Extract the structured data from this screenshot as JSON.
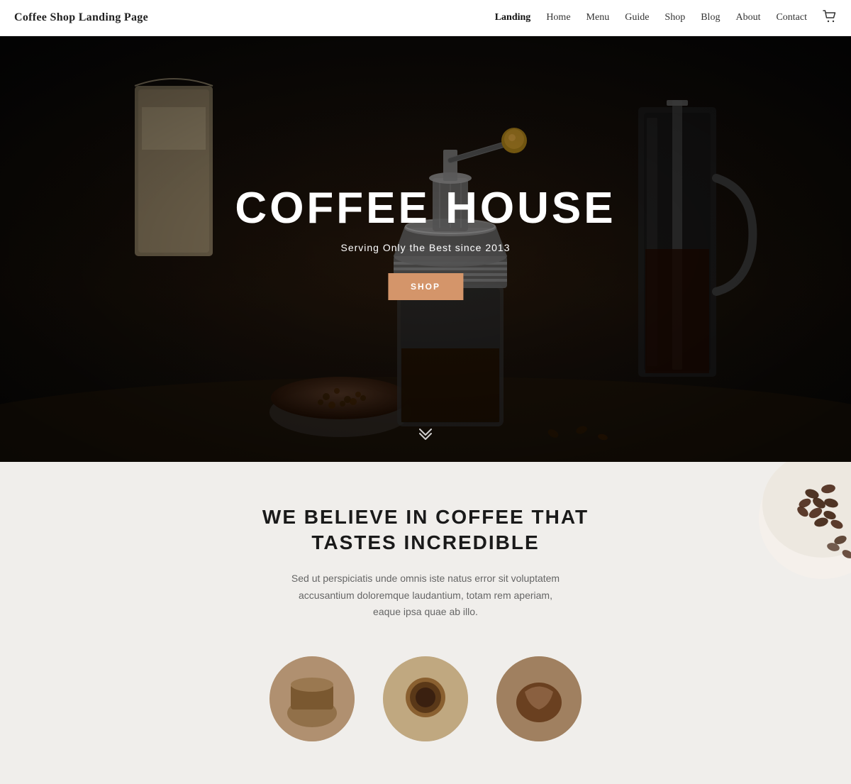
{
  "header": {
    "logo": "Coffee Shop Landing Page",
    "nav": {
      "items": [
        {
          "label": "Landing",
          "active": true
        },
        {
          "label": "Home",
          "active": false
        },
        {
          "label": "Menu",
          "active": false
        },
        {
          "label": "Guide",
          "active": false
        },
        {
          "label": "Shop",
          "active": false
        },
        {
          "label": "Blog",
          "active": false
        },
        {
          "label": "About",
          "active": false
        },
        {
          "label": "Contact",
          "active": false
        }
      ],
      "cart_icon": "🛒"
    }
  },
  "hero": {
    "title": "COFFEE HOUSE",
    "subtitle": "Serving Only the Best since 2013",
    "cta_label": "SHOP",
    "scroll_icon": "⌄⌄"
  },
  "about": {
    "title": "WE BELIEVE IN COFFEE THAT TASTES INCREDIBLE",
    "body": "Sed ut perspiciatis unde omnis iste natus error sit voluptatem accusantium doloremque laudantium, totam rem aperiam, eaque ipsa quae ab illo."
  }
}
